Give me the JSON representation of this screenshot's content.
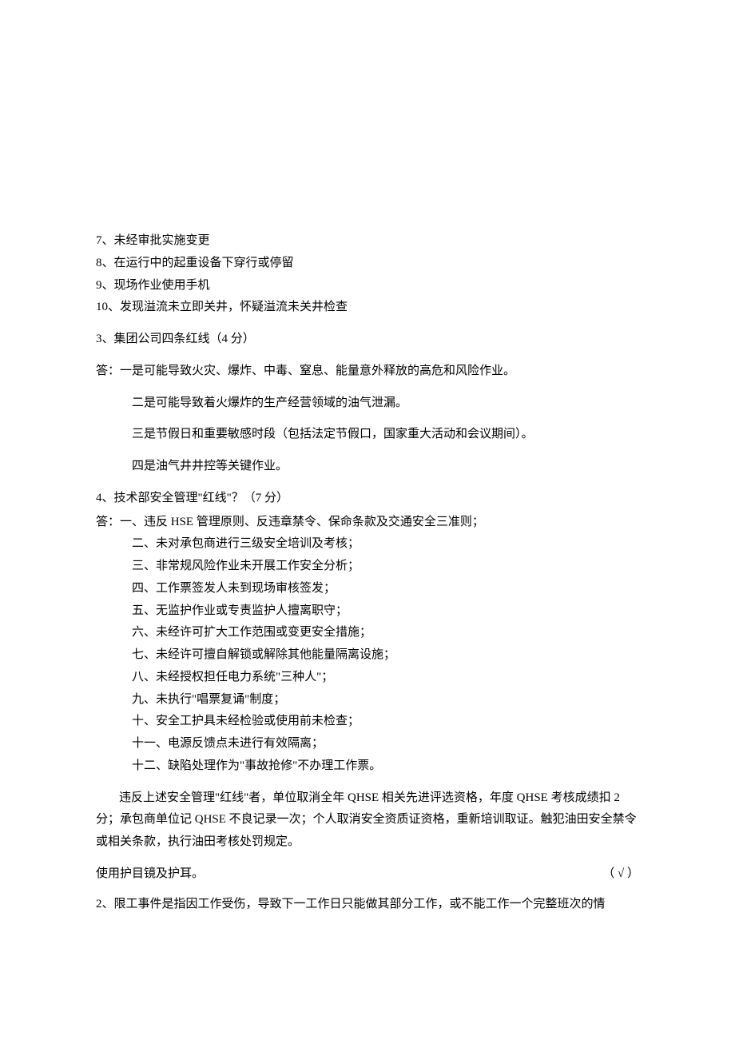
{
  "pre_items": {
    "i7": "7、未经审批实施变更",
    "i8": "8、在运行中的起重设备下穿行或停留",
    "i9": "9、现场作业使用手机",
    "i10": "10、发现溢流未立即关井，怀疑溢流未关井检查"
  },
  "q3": {
    "title": "3、集团公司四条红线（4 分）",
    "ans_lead": "答：一是可能导致火灾、爆炸、中毒、窒息、能量意外释放的高危和风险作业。",
    "l2": "二是可能导致着火爆炸的生产经营领域的油气泄漏。",
    "l3": "三是节假日和重要敏感时段（包括法定节假口，国家重大活动和会议期间）。",
    "l4": "四是油气井井控等关键作业。"
  },
  "q4": {
    "title": "4、技术部安全管理\"红线\"？（7 分）",
    "ans_lead": "答：一、违反 HSE 管理原则、反违章禁令、保命条款及交通安全三准则；",
    "l2": "二、未对承包商进行三级安全培训及考核；",
    "l3": "三、非常规风险作业未开展工作安全分析；",
    "l4": "四、工作票签发人未到现场审核签发；",
    "l5": "五、无监护作业或专责监护人擅离职守；",
    "l6": "六、未经许可扩大工作范围或变更安全措施；",
    "l7": "七、未经许可擅自解锁或解除其他能量隔离设施；",
    "l8": "八、未经授权担任电力系统\"三种人\"；",
    "l9": "九、未执行\"唱票复诵\"制度；",
    "l10": "十、安全工护具未经检验或使用前未检查；",
    "l11": "十一、电源反馈点未进行有效隔离；",
    "l12": "十二、缺陷处理作为\"事故抢修\"不办理工作票。",
    "paragraph": "违反上述安全管理\"红线\"者，单位取消全年 QHSE 相关先进评选资格，年度 QHSE 考核成绩扣 2 分；承包商单位记 QHSE 不良记录一次；个人取消安全资质证资格，重新培训取证。触犯油田安全禁令或相关条款，执行油田考核处罚规定。"
  },
  "judge": {
    "text": "使用护目镜及护耳。",
    "mark": "（ √ ）"
  },
  "q2_next": "2、限工事件是指因工作受伤，导致下一工作日只能做其部分工作，或不能工作一个完整班次的情"
}
